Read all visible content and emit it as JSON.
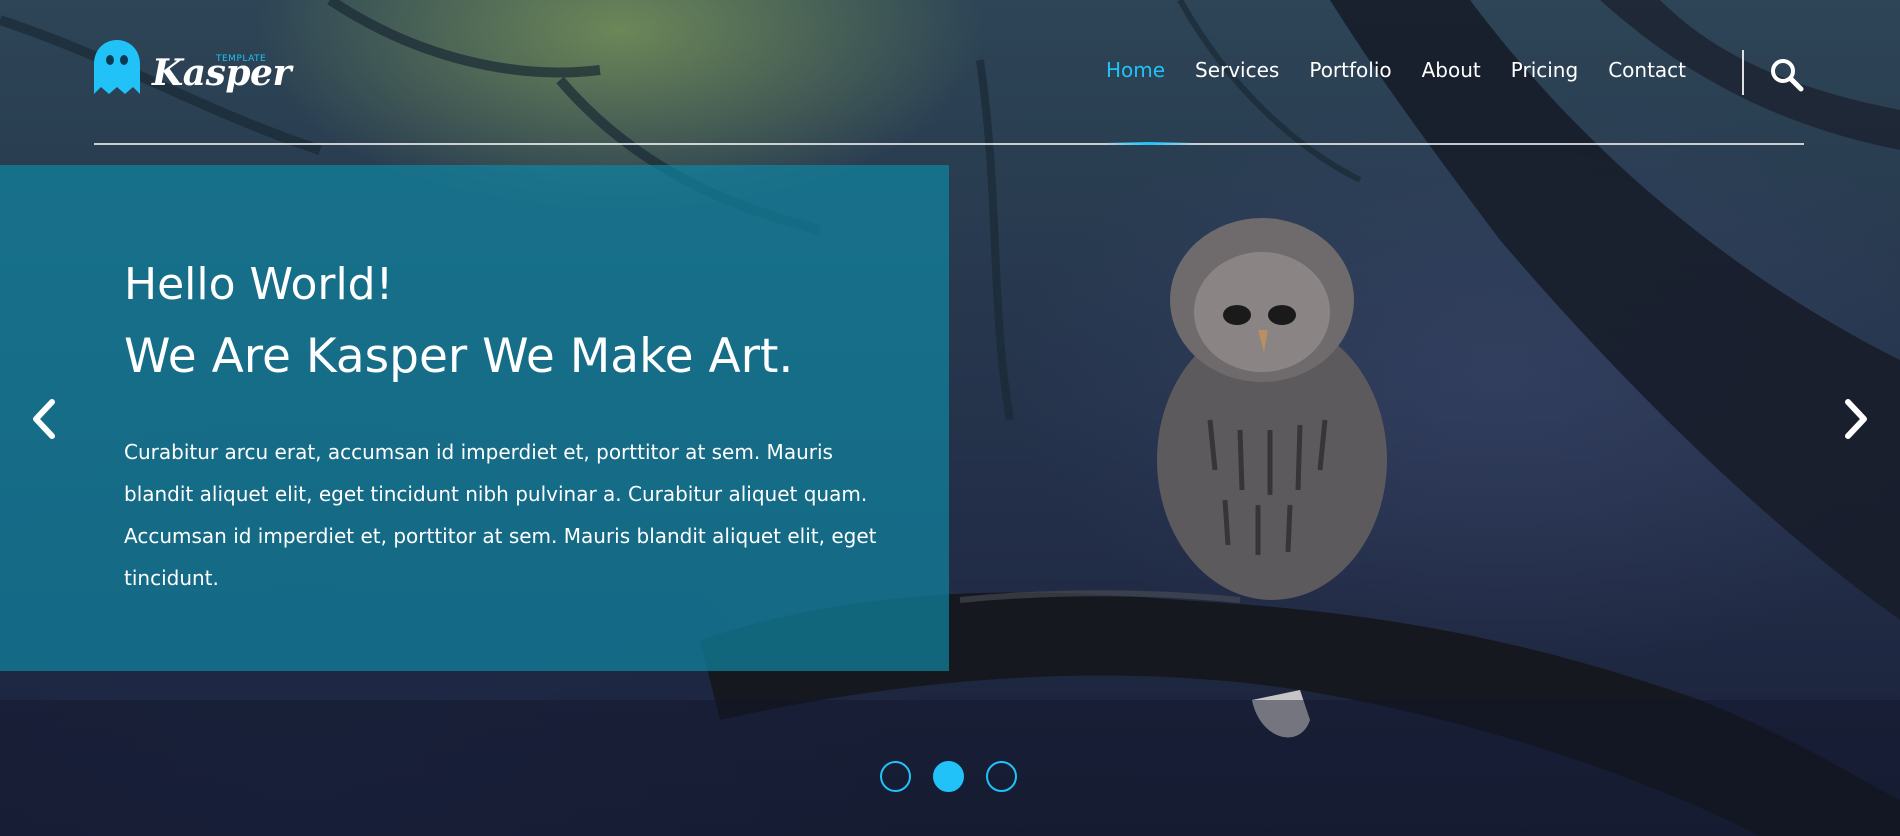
{
  "brand": {
    "name": "Kasper",
    "tagline": "TEMPLATE",
    "logo_icon": "ghost-icon",
    "accent_color": "#21c2f8"
  },
  "nav": {
    "items": [
      {
        "label": "Home",
        "active": true
      },
      {
        "label": "Services",
        "active": false
      },
      {
        "label": "Portfolio",
        "active": false
      },
      {
        "label": "About",
        "active": false
      },
      {
        "label": "Pricing",
        "active": false
      },
      {
        "label": "Contact",
        "active": false
      }
    ],
    "search_icon": "search-icon"
  },
  "hero": {
    "title": "Hello World!",
    "subtitle": "We Are Kasper We Make Art.",
    "body": "Curabitur arcu erat, accumsan id imperdiet et, porttitor at sem. Mauris blandit aliquet elit, eget tincidunt nibh pulvinar a. Curabitur aliquet quam. Accumsan id imperdiet et, porttitor at sem. Mauris blandit aliquet elit, eget tincidunt.",
    "panel_color": "#1084a0"
  },
  "slider": {
    "prev_icon": "chevron-left-icon",
    "next_icon": "chevron-right-icon",
    "dots": [
      {
        "active": false
      },
      {
        "active": true
      },
      {
        "active": false
      }
    ]
  }
}
